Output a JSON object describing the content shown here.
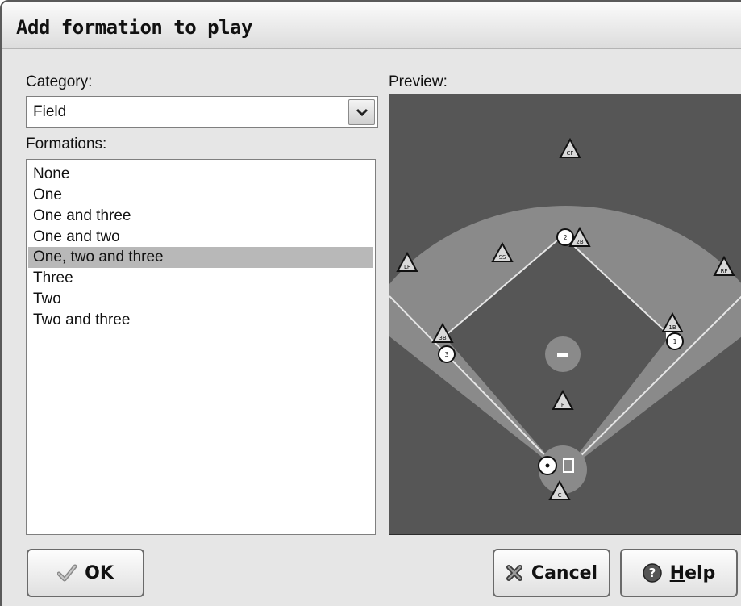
{
  "dialog": {
    "title": "Add formation to play"
  },
  "category": {
    "label": "Category:",
    "selected": "Field"
  },
  "formations": {
    "label": "Formations:",
    "items": [
      "None",
      "One",
      "One and three",
      "One and two",
      "One, two and three",
      "Three",
      "Two",
      "Two and three"
    ],
    "selected_index": 4
  },
  "preview": {
    "label": "Preview:",
    "fielders": [
      "LF",
      "CF",
      "RF",
      "SS",
      "2B",
      "1B",
      "3B",
      "P",
      "C"
    ],
    "runners": [
      "1",
      "2",
      "3"
    ]
  },
  "buttons": {
    "ok_label": "OK",
    "cancel_label": "Cancel",
    "help_label": "Help"
  },
  "icons": {
    "ok": "checkmark-icon",
    "cancel": "cross-icon",
    "help": "question-icon",
    "dropdown": "chevron-down-icon"
  }
}
